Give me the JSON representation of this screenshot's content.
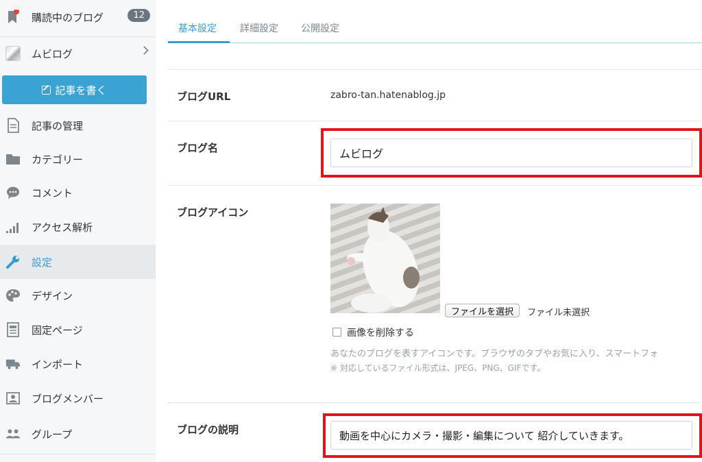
{
  "sidebar": {
    "reading": {
      "label": "購読中のブログ",
      "count": "12"
    },
    "blog": {
      "label": "ムビログ"
    },
    "write_button": "記事を書く",
    "items": [
      {
        "label": "記事の管理",
        "icon": "document-icon"
      },
      {
        "label": "カテゴリー",
        "icon": "folder-icon"
      },
      {
        "label": "コメント",
        "icon": "comment-icon"
      },
      {
        "label": "アクセス解析",
        "icon": "signal-bars-icon"
      },
      {
        "label": "設定",
        "icon": "wrench-icon",
        "active": true
      },
      {
        "label": "デザイン",
        "icon": "palette-icon"
      },
      {
        "label": "固定ページ",
        "icon": "page-icon"
      },
      {
        "label": "インポート",
        "icon": "truck-icon"
      },
      {
        "label": "ブログメンバー",
        "icon": "member-card-icon"
      },
      {
        "label": "グループ",
        "icon": "group-icon"
      }
    ]
  },
  "tabs": [
    {
      "label": "基本設定",
      "active": true
    },
    {
      "label": "詳細設定"
    },
    {
      "label": "公開設定"
    }
  ],
  "settings": {
    "url": {
      "label": "ブログURL",
      "value": "zabro-tan.hatenablog.jp"
    },
    "name": {
      "label": "ブログ名",
      "value": "ムビログ"
    },
    "icon": {
      "label": "ブログアイコン",
      "file_button": "ファイルを選択",
      "file_status": "ファイル未選択",
      "delete_label": "画像を削除する",
      "help1": "あなたのブログを表すアイコンです。ブラウザのタブやお気に入り、スマートフォ",
      "help2": "※ 対応しているファイル形式は、JPEG、PNG、GIFです。"
    },
    "description": {
      "label": "ブログの説明",
      "value": "動画を中心にカメラ・撮影・編集について 紹介していきます。"
    }
  },
  "colors": {
    "accent": "#3a9ad1",
    "highlight": "#e0151c",
    "badge": "#6b7780"
  }
}
